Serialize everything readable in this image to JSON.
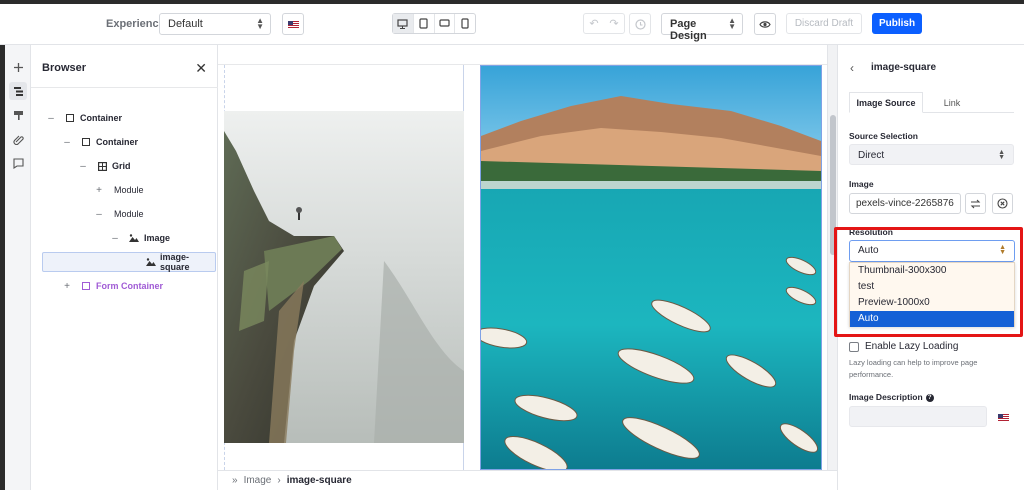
{
  "toolbar": {
    "experience_label": "Experience",
    "experience_value": "Default",
    "page_design_label": "Page Design",
    "discard_label": "Discard Draft",
    "publish_label": "Publish"
  },
  "browser": {
    "title": "Browser",
    "tree": [
      {
        "toggle": "–",
        "label": "Container"
      },
      {
        "toggle": "–",
        "label": "Container"
      },
      {
        "toggle": "–",
        "label": "Grid"
      },
      {
        "toggle": "+",
        "label": "Module"
      },
      {
        "toggle": "–",
        "label": "Module"
      },
      {
        "toggle": "–",
        "label": "Image"
      },
      {
        "toggle": "",
        "label": "image-square"
      },
      {
        "toggle": "+",
        "label": "Form Container"
      }
    ]
  },
  "breadcrumb": {
    "parent": "Image",
    "current": "image-square"
  },
  "panel": {
    "title": "image-square",
    "tabs": [
      "Image Source",
      "Link"
    ],
    "source_selection_label": "Source Selection",
    "source_selection_value": "Direct",
    "image_label": "Image",
    "image_value": "pexels-vince-2265876",
    "resolution_label": "Resolution",
    "resolution_value": "Auto",
    "resolution_options": [
      "Thumbnail-300x300",
      "test",
      "Preview-1000x0",
      "Auto"
    ],
    "lazy_label": "Enable Lazy Loading",
    "lazy_helper": "Lazy loading can help to improve page performance.",
    "image_description_label": "Image Description"
  },
  "colors": {
    "publish": "#0b5fff",
    "selected_option": "#1460d6",
    "highlight": "#e41515",
    "form_container": "#a05bd5"
  }
}
